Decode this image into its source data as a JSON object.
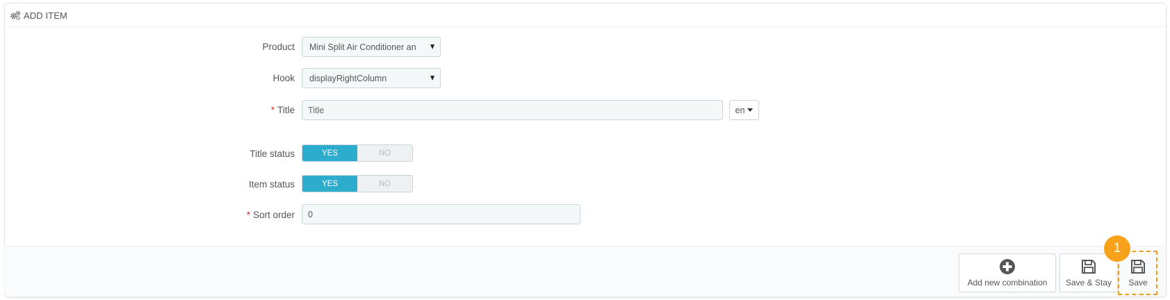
{
  "panel": {
    "title": "ADD ITEM"
  },
  "form": {
    "product": {
      "label": "Product",
      "value": "Mini Split Air Conditioner an"
    },
    "hook": {
      "label": "Hook",
      "value": "displayRightColumn"
    },
    "title": {
      "required_mark": "*",
      "label": "Title",
      "placeholder": "Title",
      "value": "",
      "lang": "en"
    },
    "title_status": {
      "label": "Title status",
      "yes": "YES",
      "no": "NO",
      "selected": "YES"
    },
    "item_status": {
      "label": "Item status",
      "yes": "YES",
      "no": "NO",
      "selected": "YES"
    },
    "sort_order": {
      "required_mark": "*",
      "label": "Sort order",
      "value": "0"
    }
  },
  "footer": {
    "add_combination_label": "Add new combination",
    "save_stay_label": "Save & Stay",
    "save_label": "Save"
  },
  "annotation": {
    "step": "1"
  },
  "icons": {
    "header": "cogs-icon",
    "add": "plus-circle-icon",
    "save": "floppy-disk-icon"
  },
  "colors": {
    "toggle_active": "#2eacce",
    "annotation": "#f7a21b",
    "required": "#e32d2d"
  }
}
